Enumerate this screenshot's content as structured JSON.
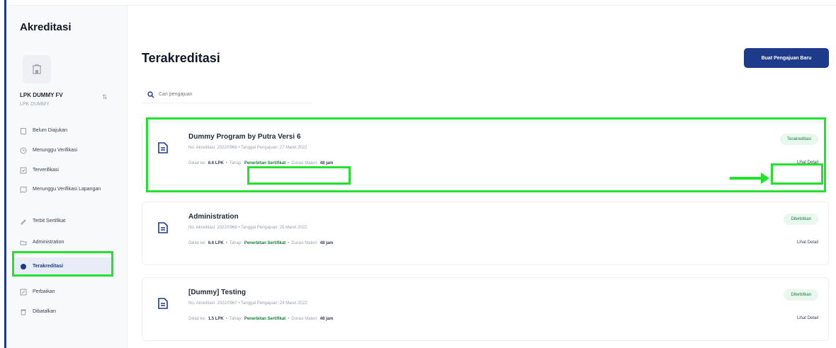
{
  "sidebar": {
    "title": "Akreditasi",
    "org_name": "LPK DUMMY FV",
    "org_sub": "LPK DUMMY",
    "items": [
      {
        "label": "Belum Diajukan",
        "icon": "clipboard-icon"
      },
      {
        "label": "Menunggu Verifikasi",
        "icon": "clock-icon"
      },
      {
        "label": "Terverifikasi",
        "icon": "check-icon"
      },
      {
        "label": "Menunggu Verifikasi Lapangan",
        "icon": "map-icon"
      },
      {
        "label": "Terbit Sertifikat",
        "icon": "pen-icon"
      },
      {
        "label": "Administration",
        "icon": "folder-icon"
      },
      {
        "label": "Terakreditasi",
        "icon": "award-icon",
        "active": true
      },
      {
        "label": "Perbaikan",
        "icon": "edit-icon"
      },
      {
        "label": "Dibatalkan",
        "icon": "trash-icon"
      }
    ]
  },
  "main": {
    "title": "Terakreditasi",
    "new_button": "Buat Pengajuan Baru",
    "search_placeholder": "Cari pengajuan"
  },
  "cards": [
    {
      "title": "Dummy Program by Putra Versi 6",
      "meta": "No. Akreditasi: 2022/0968 • Tanggal Pengajuan: 27 Maret 2022",
      "info_prefix": "Diklat ke:",
      "info_value": "6.6 LPK",
      "status_label": "Tahap:",
      "status_value": "Penerbitan Sertifikat",
      "duration_label": "Durasi Materi:",
      "duration_value": "48 jam",
      "badge": "Terakreditasi",
      "link": "Lihat Detail"
    },
    {
      "title": "Administration",
      "meta": "No. Akreditasi: 2022/0968 • Tanggal Pengajuan: 25 Maret 2022",
      "info_prefix": "Diklat ke:",
      "info_value": "6.6 LPK",
      "status_label": "Tahap:",
      "status_value": "Penerbitan Sertifikat",
      "duration_label": "Durasi Materi:",
      "duration_value": "48 jam",
      "badge": "Diterbitkan",
      "link": "Lihat Detail"
    },
    {
      "title": "[Dummy] Testing",
      "meta": "No. Akreditasi: 2022/0967 • Tanggal Pengajuan: 24 Maret 2022",
      "info_prefix": "Diklat ke:",
      "info_value": "1.5 LPK",
      "status_label": "Tahap:",
      "status_value": "Penerbitan Sertifikat",
      "duration_label": "Durasi Materi:",
      "duration_value": "48 jam",
      "badge": "Diterbitkan",
      "link": "Lihat Detail"
    }
  ],
  "colors": {
    "accent": "#1e3a8a",
    "highlight": "#22e32c",
    "badge_green": "#15803d"
  }
}
